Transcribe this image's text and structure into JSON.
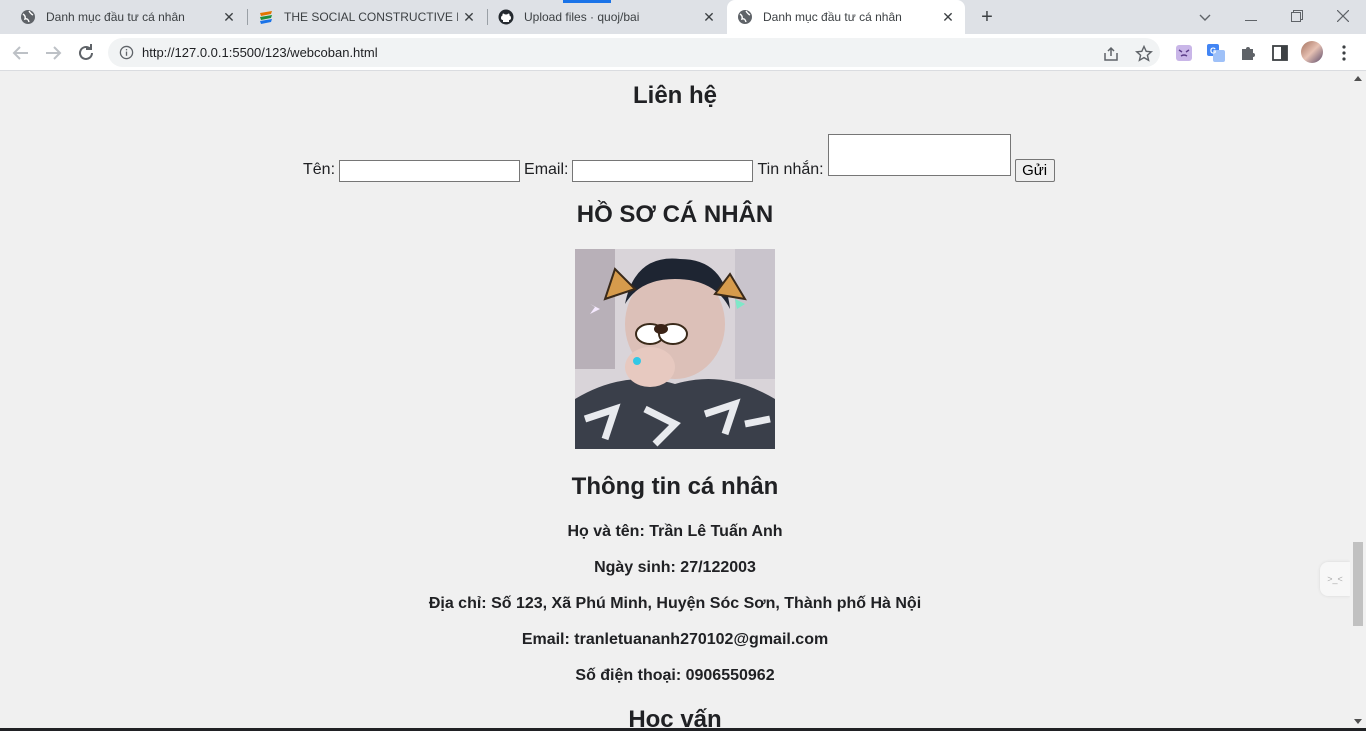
{
  "browser": {
    "tabs": [
      {
        "title": "Danh mục đầu tư cá nhân",
        "favicon": "globe-icon",
        "active": false
      },
      {
        "title": "THE SOCIAL CONSTRUCTIVE LEA",
        "favicon": "layers-logo-icon",
        "active": false
      },
      {
        "title": "Upload files · quoj/bai",
        "favicon": "github-icon",
        "active": false
      },
      {
        "title": "Danh mục đầu tư cá nhân",
        "favicon": "globe-icon",
        "active": true
      }
    ],
    "url": "http://127.0.0.1:5500/123/webcoban.html",
    "accent_color": "#1a73e8"
  },
  "page": {
    "contact": {
      "heading": "Liên hệ",
      "name_label": "Tên:",
      "email_label": "Email:",
      "message_label": "Tin nhắn:",
      "submit_label": "Gửi",
      "name_value": "",
      "email_value": "",
      "message_value": ""
    },
    "profile": {
      "heading": "HỒ SƠ CÁ NHÂN"
    },
    "info": {
      "heading": "Thông tin cá nhân",
      "lines": [
        "Họ và tên: Trần Lê Tuấn Anh",
        "Ngày sinh: 27/122003",
        "Địa chỉ: Số 123, Xã Phú Minh, Huyện Sóc Sơn, Thành phố Hà Nội",
        "Email: tranletuananh270102@gmail.com",
        "Số điện thoại: 0906550962"
      ]
    },
    "education": {
      "heading": "Học vấn"
    }
  }
}
